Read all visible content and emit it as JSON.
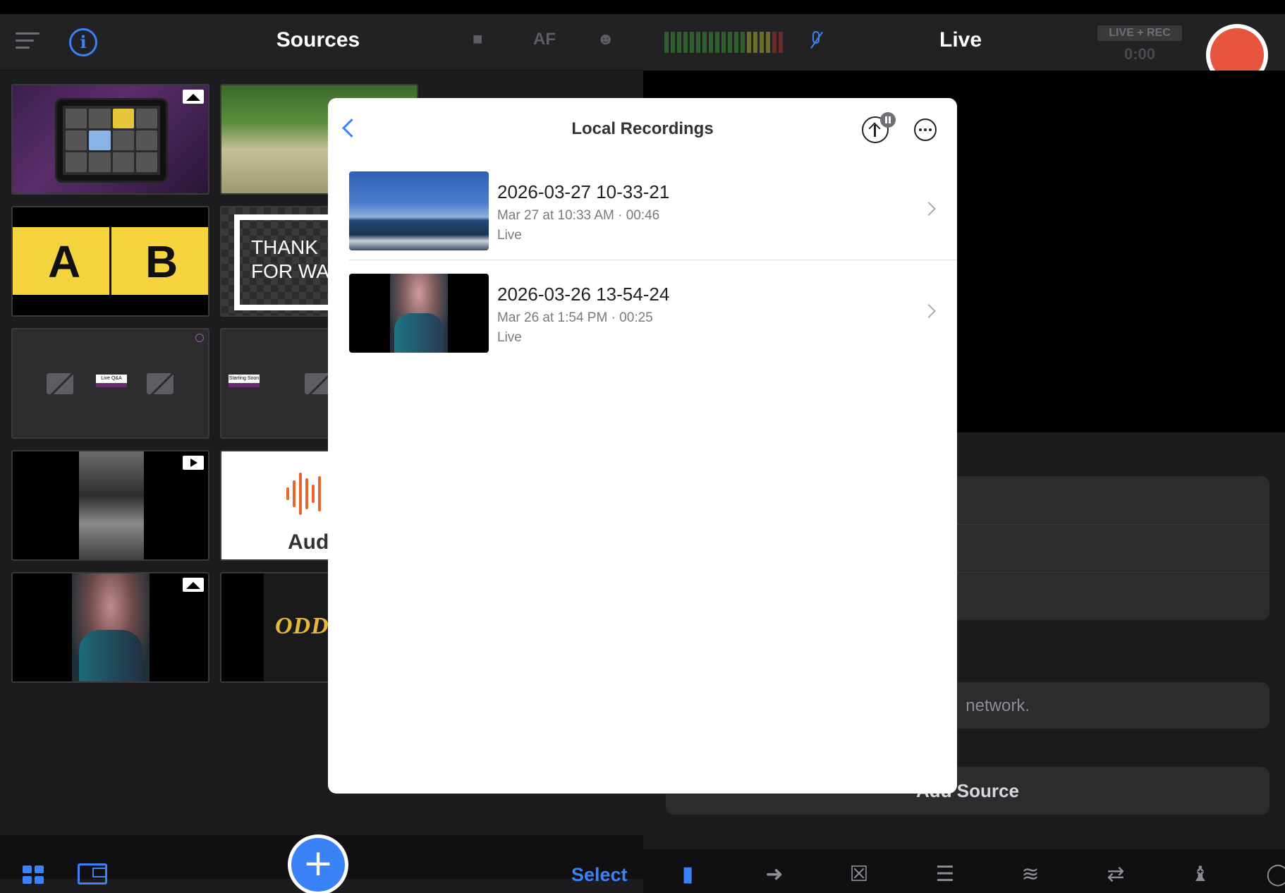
{
  "left_panel": {
    "title": "Sources",
    "autofocus_label": "AF",
    "select_label": "Select",
    "tiles": [
      {
        "id": "tablet",
        "badge": "image"
      },
      {
        "id": "wheat"
      },
      {
        "id": "ab",
        "letters": [
          "A",
          "B"
        ]
      },
      {
        "id": "thank",
        "text_line1": "THANK",
        "text_line2": "FOR WAT"
      },
      {
        "id": "cams1",
        "label": "Live Q&A"
      },
      {
        "id": "cams2",
        "label": "Starting Soon"
      },
      {
        "id": "photo",
        "badge": "video"
      },
      {
        "id": "audio",
        "text": "Aud"
      },
      {
        "id": "portrait",
        "badge": "image"
      },
      {
        "id": "odds",
        "text": "ODDS"
      }
    ]
  },
  "right_panel": {
    "title": "Live",
    "live_rec_badge": "LIVE + REC",
    "live_rec_time": "0:00",
    "network_message": "network.",
    "add_source_label": "Add Source"
  },
  "modal": {
    "title": "Local Recordings",
    "recordings": [
      {
        "name": "2026-03-27 10-33-21",
        "meta": "Mar 27 at 10:33 AM · 00:46",
        "kind": "Live"
      },
      {
        "name": "2026-03-26 13-54-24",
        "meta": "Mar 26 at 1:54 PM · 00:25",
        "kind": "Live"
      }
    ]
  },
  "colors": {
    "accent": "#3b82f6",
    "record": "#e8553f",
    "panel_bg": "#1c1c1e",
    "modal_bg": "#ffffff"
  }
}
